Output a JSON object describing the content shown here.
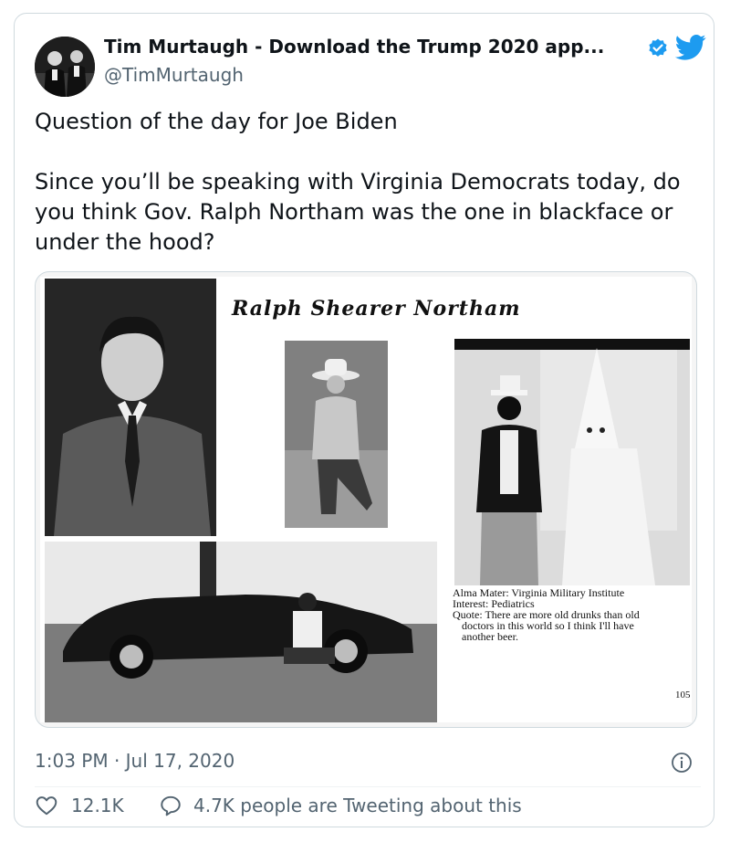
{
  "tweet": {
    "author_name": "Tim Murtaugh - Download the Trump 2020 app...",
    "handle": "@TimMurtaugh",
    "paragraph_1": "Question of the day for Joe Biden",
    "paragraph_2": "Since you’ll be speaking with Virginia Democrats today, do you think Gov. Ralph Northam was the one in blackface or under the hood?",
    "timestamp": "1:03 PM · Jul 17, 2020"
  },
  "image": {
    "yearbook_title": "Ralph Shearer Northam",
    "caption_lines": [
      "Alma Mater: Virginia Military Institute",
      "Interest: Pediatrics",
      "Quote: There are more old drunks than old",
      "doctors in this world so I think I'll have",
      "another beer."
    ],
    "page_number": "105"
  },
  "engagement": {
    "likes": "12.1K",
    "conversation": "4.7K people are Tweeting about this"
  },
  "icons": {
    "verified": "verified-badge-icon",
    "twitter": "twitter-bird-icon",
    "info": "info-icon",
    "like": "heart-icon",
    "conversation": "speech-bubble-icon"
  },
  "colors": {
    "twitter_blue": "#1d9bf0",
    "secondary_text": "#536471",
    "border": "#cfd9de"
  }
}
